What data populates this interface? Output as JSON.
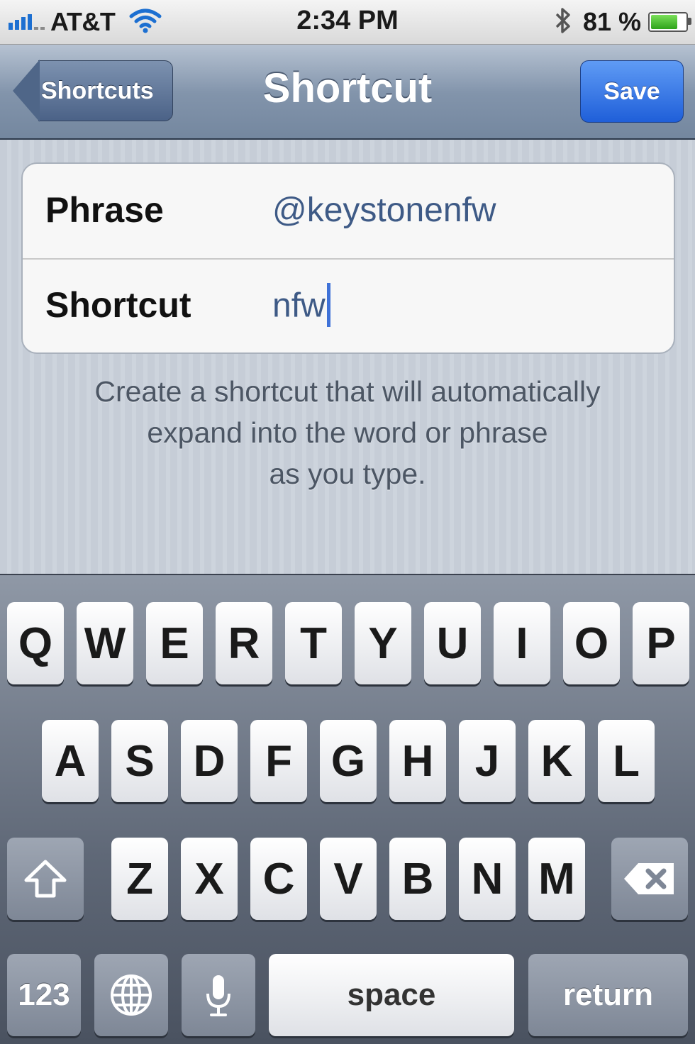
{
  "status_bar": {
    "carrier": "AT&T",
    "time": "2:34 PM",
    "battery": "81 %",
    "battery_level": 0.81,
    "icons": [
      "signal-icon",
      "wifi-icon",
      "bluetooth-icon",
      "battery-icon"
    ]
  },
  "nav": {
    "back_label": "Shortcuts",
    "title": "Shortcut",
    "save_label": "Save"
  },
  "form": {
    "phrase_label": "Phrase",
    "phrase_value": "@keystonenfw",
    "shortcut_label": "Shortcut",
    "shortcut_value": "nfw"
  },
  "footer": {
    "line1": "Create a shortcut that will automatically",
    "line2": "expand into the word or phrase",
    "line3": "as you type."
  },
  "keyboard": {
    "row1": [
      "Q",
      "W",
      "E",
      "R",
      "T",
      "Y",
      "U",
      "I",
      "O",
      "P"
    ],
    "row2": [
      "A",
      "S",
      "D",
      "F",
      "G",
      "H",
      "J",
      "K",
      "L"
    ],
    "row3": [
      "Z",
      "X",
      "C",
      "V",
      "B",
      "N",
      "M"
    ],
    "numbers_label": "123",
    "space_label": "space",
    "return_label": "return"
  },
  "colors": {
    "accent": "#1f5fd9",
    "nav_bar": "#8294ab",
    "value_text": "#3e5a86"
  }
}
